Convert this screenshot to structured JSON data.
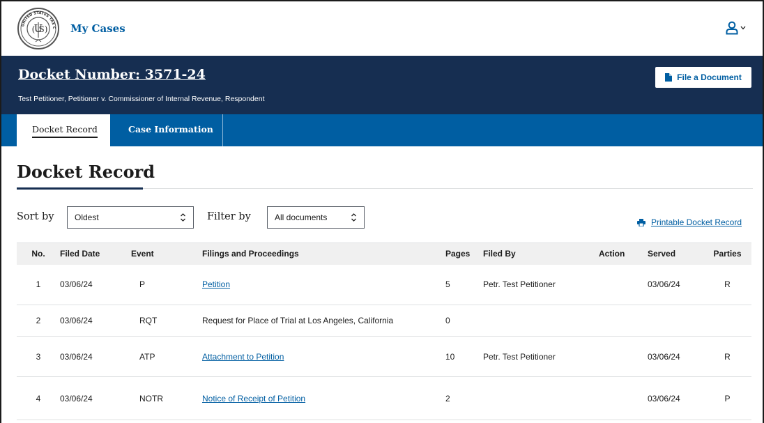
{
  "header": {
    "nav_link": "My Cases",
    "seal_text": "UNITED STATES TAX COURT",
    "seal_letters": "UᵀS"
  },
  "case": {
    "docket_number": "Docket Number: 3571-24",
    "caption": "Test Petitioner, Petitioner v. Commissioner of Internal Revenue, Respondent",
    "file_document_label": "File a Document"
  },
  "tabs": [
    {
      "label": "Docket Record",
      "active": true
    },
    {
      "label": "Case Information",
      "active": false
    }
  ],
  "section": {
    "title": "Docket Record"
  },
  "controls": {
    "sort_label": "Sort by",
    "sort_value": "Oldest",
    "filter_label": "Filter by",
    "filter_value": "All documents",
    "print_label": "Printable Docket Record"
  },
  "table": {
    "headers": [
      "No.",
      "Filed Date",
      "Event",
      "Filings and Proceedings",
      "Pages",
      "Filed By",
      "Action",
      "Served",
      "Parties"
    ],
    "rows": [
      {
        "no": "1",
        "date": "03/06/24",
        "event": "P",
        "filing": "Petition",
        "link": true,
        "pages": "5",
        "filed_by": "Petr. Test Petitioner",
        "action": "",
        "served": "03/06/24",
        "parties": "R"
      },
      {
        "no": "2",
        "date": "03/06/24",
        "event": "RQT",
        "filing": "Request for Place of Trial at Los Angeles, California",
        "link": false,
        "pages": "0",
        "filed_by": "",
        "action": "",
        "served": "",
        "parties": ""
      },
      {
        "no": "3",
        "date": "03/06/24",
        "event": "ATP",
        "filing": "Attachment to Petition",
        "link": true,
        "pages": "10",
        "filed_by": "Petr. Test Petitioner",
        "action": "",
        "served": "03/06/24",
        "parties": "R"
      },
      {
        "no": "4",
        "date": "03/06/24",
        "event": "NOTR",
        "filing": "Notice of Receipt of Petition",
        "link": true,
        "pages": "2",
        "filed_by": "",
        "action": "",
        "served": "03/06/24",
        "parties": "P"
      }
    ]
  },
  "colors": {
    "navy": "#162e51",
    "blue": "#005ea2",
    "link": "#005ea2",
    "header_row": "#f0f0f0"
  },
  "icons": {
    "user": "user-icon",
    "chevron": "chevron-down-icon",
    "file": "file-icon",
    "print": "print-icon",
    "seal": "court-seal-logo",
    "select_arrows": "select-arrows-icon"
  }
}
